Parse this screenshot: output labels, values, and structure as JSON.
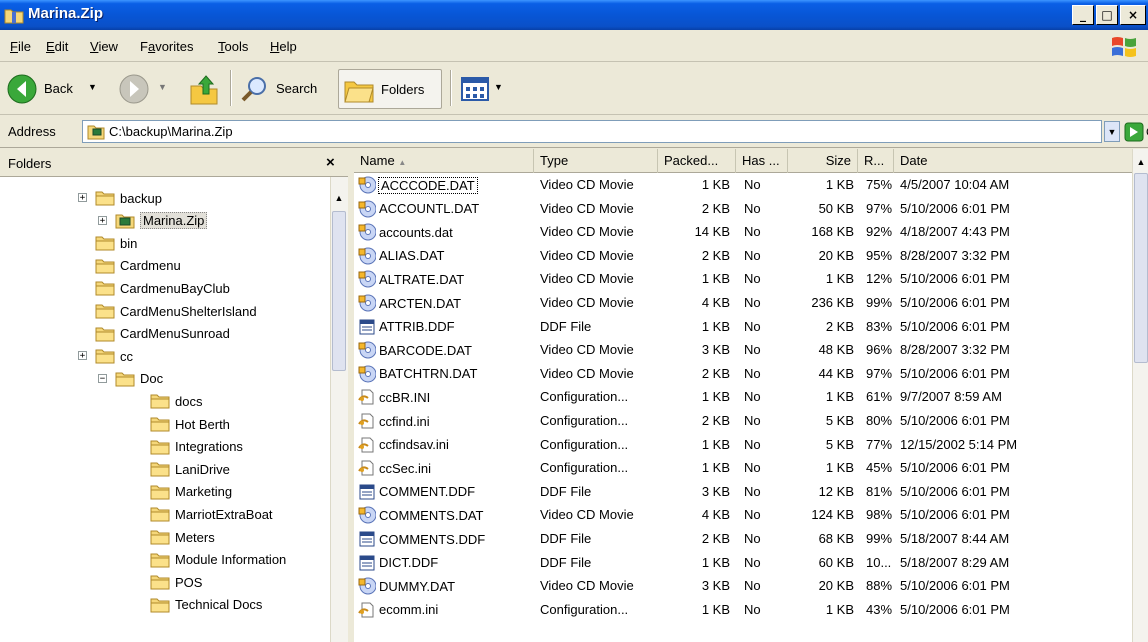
{
  "window": {
    "title": "Marina.Zip"
  },
  "menu": [
    {
      "label": "File",
      "key": "F",
      "rest": "ile"
    },
    {
      "label": "Edit",
      "key": "E",
      "rest": "dit"
    },
    {
      "label": "View",
      "key": "V",
      "rest": "iew"
    },
    {
      "label": "Favorites",
      "key": "a",
      "pre": "F",
      "rest": "vorites"
    },
    {
      "label": "Tools",
      "key": "T",
      "rest": "ools"
    },
    {
      "label": "Help",
      "key": "H",
      "rest": "elp"
    }
  ],
  "toolbar": {
    "back_label": "Back",
    "search_label": "Search",
    "folders_label": "Folders"
  },
  "address": {
    "label": "Address",
    "value": "C:\\backup\\Marina.Zip",
    "go_label": "Go"
  },
  "folders": {
    "header": "Folders",
    "close_glyph": "×",
    "tree": [
      {
        "label": "backup",
        "level": 0,
        "expander": "+",
        "icon": "folder-icon"
      },
      {
        "label": "Marina.Zip",
        "level": 1,
        "expander": "+",
        "icon": "zip-folder-icon",
        "selected": true
      },
      {
        "label": "bin",
        "level": 0,
        "icon": "folder-icon"
      },
      {
        "label": "Cardmenu",
        "level": 0,
        "icon": "folder-icon"
      },
      {
        "label": "CardmenuBayClub",
        "level": 0,
        "icon": "folder-icon"
      },
      {
        "label": "CardMenuShelterIsland",
        "level": 0,
        "icon": "folder-icon"
      },
      {
        "label": "CardMenuSunroad",
        "level": 0,
        "icon": "folder-icon"
      },
      {
        "label": "cc",
        "level": 0,
        "expander": "+",
        "icon": "folder-icon"
      },
      {
        "label": "Doc",
        "level": 1,
        "expander": "−",
        "icon": "folder-icon"
      },
      {
        "label": "docs",
        "level": 2,
        "icon": "folder-icon"
      },
      {
        "label": "Hot Berth",
        "level": 2,
        "icon": "folder-icon"
      },
      {
        "label": "Integrations",
        "level": 2,
        "icon": "folder-icon"
      },
      {
        "label": "LaniDrive",
        "level": 2,
        "icon": "folder-icon"
      },
      {
        "label": "Marketing",
        "level": 2,
        "icon": "folder-icon"
      },
      {
        "label": "MarriotExtraBoat",
        "level": 2,
        "icon": "folder-icon"
      },
      {
        "label": "Meters",
        "level": 2,
        "icon": "folder-icon"
      },
      {
        "label": "Module Information",
        "level": 2,
        "icon": "folder-icon"
      },
      {
        "label": "POS",
        "level": 2,
        "icon": "folder-icon"
      },
      {
        "label": "Technical Docs",
        "level": 2,
        "icon": "folder-icon"
      }
    ]
  },
  "list": {
    "columns": [
      "Name",
      "Type",
      "Packed...",
      "Has ...",
      "Size",
      "R...",
      "Date"
    ],
    "sort_glyph": "▲",
    "rows": [
      {
        "name": "ACCCODE.DAT",
        "type": "Video CD Movie",
        "packed": "1 KB",
        "has": "No",
        "size": "1 KB",
        "ratio": "75%",
        "date": "4/5/2007 10:04 AM",
        "icon": "video-cd-icon",
        "focus": true
      },
      {
        "name": "ACCOUNTL.DAT",
        "type": "Video CD Movie",
        "packed": "2 KB",
        "has": "No",
        "size": "50 KB",
        "ratio": "97%",
        "date": "5/10/2006 6:01 PM",
        "icon": "video-cd-icon"
      },
      {
        "name": "accounts.dat",
        "type": "Video CD Movie",
        "packed": "14 KB",
        "has": "No",
        "size": "168 KB",
        "ratio": "92%",
        "date": "4/18/2007 4:43 PM",
        "icon": "video-cd-icon"
      },
      {
        "name": "ALIAS.DAT",
        "type": "Video CD Movie",
        "packed": "2 KB",
        "has": "No",
        "size": "20 KB",
        "ratio": "95%",
        "date": "8/28/2007 3:32 PM",
        "icon": "video-cd-icon"
      },
      {
        "name": "ALTRATE.DAT",
        "type": "Video CD Movie",
        "packed": "1 KB",
        "has": "No",
        "size": "1 KB",
        "ratio": "12%",
        "date": "5/10/2006 6:01 PM",
        "icon": "video-cd-icon"
      },
      {
        "name": "ARCTEN.DAT",
        "type": "Video CD Movie",
        "packed": "4 KB",
        "has": "No",
        "size": "236 KB",
        "ratio": "99%",
        "date": "5/10/2006 6:01 PM",
        "icon": "video-cd-icon"
      },
      {
        "name": "ATTRIB.DDF",
        "type": "DDF File",
        "packed": "1 KB",
        "has": "No",
        "size": "2 KB",
        "ratio": "83%",
        "date": "5/10/2006 6:01 PM",
        "icon": "ddf-file-icon"
      },
      {
        "name": "BARCODE.DAT",
        "type": "Video CD Movie",
        "packed": "3 KB",
        "has": "No",
        "size": "48 KB",
        "ratio": "96%",
        "date": "8/28/2007 3:32 PM",
        "icon": "video-cd-icon"
      },
      {
        "name": "BATCHTRN.DAT",
        "type": "Video CD Movie",
        "packed": "2 KB",
        "has": "No",
        "size": "44 KB",
        "ratio": "97%",
        "date": "5/10/2006 6:01 PM",
        "icon": "video-cd-icon"
      },
      {
        "name": "ccBR.INI",
        "type": "Configuration...",
        "packed": "1 KB",
        "has": "No",
        "size": "1 KB",
        "ratio": "61%",
        "date": "9/7/2007 8:59 AM",
        "icon": "config-file-icon"
      },
      {
        "name": "ccfind.ini",
        "type": "Configuration...",
        "packed": "2 KB",
        "has": "No",
        "size": "5 KB",
        "ratio": "80%",
        "date": "5/10/2006 6:01 PM",
        "icon": "config-file-icon"
      },
      {
        "name": "ccfindsav.ini",
        "type": "Configuration...",
        "packed": "1 KB",
        "has": "No",
        "size": "5 KB",
        "ratio": "77%",
        "date": "12/15/2002 5:14 PM",
        "icon": "config-file-icon"
      },
      {
        "name": "ccSec.ini",
        "type": "Configuration...",
        "packed": "1 KB",
        "has": "No",
        "size": "1 KB",
        "ratio": "45%",
        "date": "5/10/2006 6:01 PM",
        "icon": "config-file-icon"
      },
      {
        "name": "COMMENT.DDF",
        "type": "DDF File",
        "packed": "3 KB",
        "has": "No",
        "size": "12 KB",
        "ratio": "81%",
        "date": "5/10/2006 6:01 PM",
        "icon": "ddf-file-icon"
      },
      {
        "name": "COMMENTS.DAT",
        "type": "Video CD Movie",
        "packed": "4 KB",
        "has": "No",
        "size": "124 KB",
        "ratio": "98%",
        "date": "5/10/2006 6:01 PM",
        "icon": "video-cd-icon"
      },
      {
        "name": "COMMENTS.DDF",
        "type": "DDF File",
        "packed": "2 KB",
        "has": "No",
        "size": "68 KB",
        "ratio": "99%",
        "date": "5/18/2007 8:44 AM",
        "icon": "ddf-file-icon"
      },
      {
        "name": "DICT.DDF",
        "type": "DDF File",
        "packed": "1 KB",
        "has": "No",
        "size": "60 KB",
        "ratio": "10...",
        "date": "5/18/2007 8:29 AM",
        "icon": "ddf-file-icon"
      },
      {
        "name": "DUMMY.DAT",
        "type": "Video CD Movie",
        "packed": "3 KB",
        "has": "No",
        "size": "20 KB",
        "ratio": "88%",
        "date": "5/10/2006 6:01 PM",
        "icon": "video-cd-icon"
      },
      {
        "name": "ecomm.ini",
        "type": "Configuration...",
        "packed": "1 KB",
        "has": "No",
        "size": "1 KB",
        "ratio": "43%",
        "date": "5/10/2006 6:01 PM",
        "icon": "config-file-icon"
      }
    ]
  }
}
